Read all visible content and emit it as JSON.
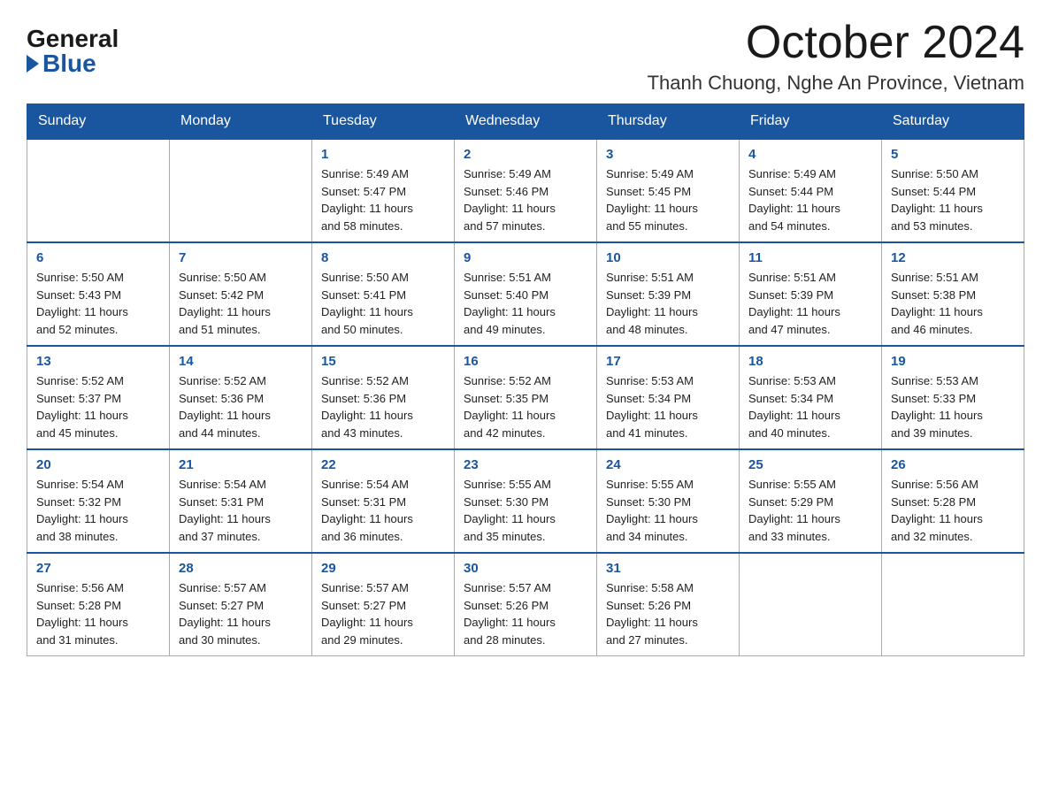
{
  "logo": {
    "general": "General",
    "blue": "Blue",
    "triangle": "▶"
  },
  "header": {
    "month": "October 2024",
    "location": "Thanh Chuong, Nghe An Province, Vietnam"
  },
  "weekdays": [
    "Sunday",
    "Monday",
    "Tuesday",
    "Wednesday",
    "Thursday",
    "Friday",
    "Saturday"
  ],
  "weeks": [
    [
      {
        "day": "",
        "info": ""
      },
      {
        "day": "",
        "info": ""
      },
      {
        "day": "1",
        "info": "Sunrise: 5:49 AM\nSunset: 5:47 PM\nDaylight: 11 hours\nand 58 minutes."
      },
      {
        "day": "2",
        "info": "Sunrise: 5:49 AM\nSunset: 5:46 PM\nDaylight: 11 hours\nand 57 minutes."
      },
      {
        "day": "3",
        "info": "Sunrise: 5:49 AM\nSunset: 5:45 PM\nDaylight: 11 hours\nand 55 minutes."
      },
      {
        "day": "4",
        "info": "Sunrise: 5:49 AM\nSunset: 5:44 PM\nDaylight: 11 hours\nand 54 minutes."
      },
      {
        "day": "5",
        "info": "Sunrise: 5:50 AM\nSunset: 5:44 PM\nDaylight: 11 hours\nand 53 minutes."
      }
    ],
    [
      {
        "day": "6",
        "info": "Sunrise: 5:50 AM\nSunset: 5:43 PM\nDaylight: 11 hours\nand 52 minutes."
      },
      {
        "day": "7",
        "info": "Sunrise: 5:50 AM\nSunset: 5:42 PM\nDaylight: 11 hours\nand 51 minutes."
      },
      {
        "day": "8",
        "info": "Sunrise: 5:50 AM\nSunset: 5:41 PM\nDaylight: 11 hours\nand 50 minutes."
      },
      {
        "day": "9",
        "info": "Sunrise: 5:51 AM\nSunset: 5:40 PM\nDaylight: 11 hours\nand 49 minutes."
      },
      {
        "day": "10",
        "info": "Sunrise: 5:51 AM\nSunset: 5:39 PM\nDaylight: 11 hours\nand 48 minutes."
      },
      {
        "day": "11",
        "info": "Sunrise: 5:51 AM\nSunset: 5:39 PM\nDaylight: 11 hours\nand 47 minutes."
      },
      {
        "day": "12",
        "info": "Sunrise: 5:51 AM\nSunset: 5:38 PM\nDaylight: 11 hours\nand 46 minutes."
      }
    ],
    [
      {
        "day": "13",
        "info": "Sunrise: 5:52 AM\nSunset: 5:37 PM\nDaylight: 11 hours\nand 45 minutes."
      },
      {
        "day": "14",
        "info": "Sunrise: 5:52 AM\nSunset: 5:36 PM\nDaylight: 11 hours\nand 44 minutes."
      },
      {
        "day": "15",
        "info": "Sunrise: 5:52 AM\nSunset: 5:36 PM\nDaylight: 11 hours\nand 43 minutes."
      },
      {
        "day": "16",
        "info": "Sunrise: 5:52 AM\nSunset: 5:35 PM\nDaylight: 11 hours\nand 42 minutes."
      },
      {
        "day": "17",
        "info": "Sunrise: 5:53 AM\nSunset: 5:34 PM\nDaylight: 11 hours\nand 41 minutes."
      },
      {
        "day": "18",
        "info": "Sunrise: 5:53 AM\nSunset: 5:34 PM\nDaylight: 11 hours\nand 40 minutes."
      },
      {
        "day": "19",
        "info": "Sunrise: 5:53 AM\nSunset: 5:33 PM\nDaylight: 11 hours\nand 39 minutes."
      }
    ],
    [
      {
        "day": "20",
        "info": "Sunrise: 5:54 AM\nSunset: 5:32 PM\nDaylight: 11 hours\nand 38 minutes."
      },
      {
        "day": "21",
        "info": "Sunrise: 5:54 AM\nSunset: 5:31 PM\nDaylight: 11 hours\nand 37 minutes."
      },
      {
        "day": "22",
        "info": "Sunrise: 5:54 AM\nSunset: 5:31 PM\nDaylight: 11 hours\nand 36 minutes."
      },
      {
        "day": "23",
        "info": "Sunrise: 5:55 AM\nSunset: 5:30 PM\nDaylight: 11 hours\nand 35 minutes."
      },
      {
        "day": "24",
        "info": "Sunrise: 5:55 AM\nSunset: 5:30 PM\nDaylight: 11 hours\nand 34 minutes."
      },
      {
        "day": "25",
        "info": "Sunrise: 5:55 AM\nSunset: 5:29 PM\nDaylight: 11 hours\nand 33 minutes."
      },
      {
        "day": "26",
        "info": "Sunrise: 5:56 AM\nSunset: 5:28 PM\nDaylight: 11 hours\nand 32 minutes."
      }
    ],
    [
      {
        "day": "27",
        "info": "Sunrise: 5:56 AM\nSunset: 5:28 PM\nDaylight: 11 hours\nand 31 minutes."
      },
      {
        "day": "28",
        "info": "Sunrise: 5:57 AM\nSunset: 5:27 PM\nDaylight: 11 hours\nand 30 minutes."
      },
      {
        "day": "29",
        "info": "Sunrise: 5:57 AM\nSunset: 5:27 PM\nDaylight: 11 hours\nand 29 minutes."
      },
      {
        "day": "30",
        "info": "Sunrise: 5:57 AM\nSunset: 5:26 PM\nDaylight: 11 hours\nand 28 minutes."
      },
      {
        "day": "31",
        "info": "Sunrise: 5:58 AM\nSunset: 5:26 PM\nDaylight: 11 hours\nand 27 minutes."
      },
      {
        "day": "",
        "info": ""
      },
      {
        "day": "",
        "info": ""
      }
    ]
  ]
}
